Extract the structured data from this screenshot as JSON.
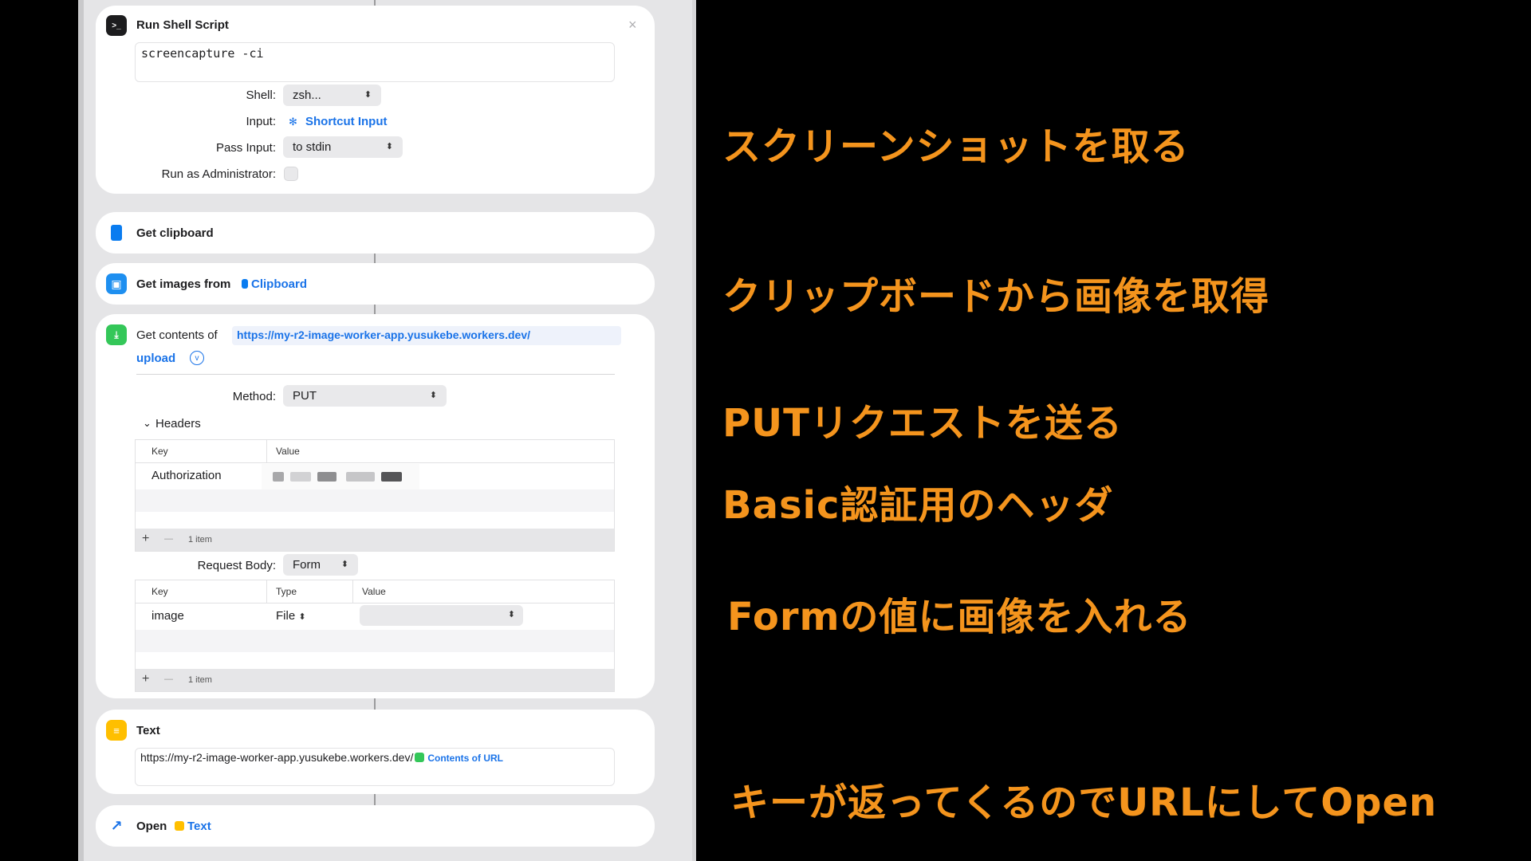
{
  "run_shell": {
    "title": "Run Shell Script",
    "script": "screencapture -ci",
    "shell_label": "Shell:",
    "shell_value": "zsh...",
    "input_label": "Input:",
    "input_value": "Shortcut Input",
    "pass_input_label": "Pass Input:",
    "pass_input_value": "to stdin",
    "admin_label": "Run as Administrator:"
  },
  "get_clipboard": {
    "title": "Get clipboard"
  },
  "get_images": {
    "title": "Get images from",
    "source": "Clipboard"
  },
  "get_contents": {
    "title": "Get contents of",
    "url_part1": "https://my-r2-image-worker-app.yusukebe.workers.dev/",
    "url_part2": "upload",
    "method_label": "Method:",
    "method_value": "PUT",
    "headers_label": "Headers",
    "headers_table": {
      "columns": [
        "Key",
        "Value"
      ],
      "rows": [
        {
          "key": "Authorization"
        }
      ],
      "count": "1 item"
    },
    "request_body_label": "Request Body:",
    "request_body_value": "Form",
    "form_table": {
      "columns": [
        "Key",
        "Type",
        "Value"
      ],
      "rows": [
        {
          "key": "image",
          "type": "File"
        }
      ],
      "count": "1 item"
    }
  },
  "text_action": {
    "title": "Text",
    "content": "https://my-r2-image-worker-app.yusukebe.workers.dev/",
    "token": "Contents of URL"
  },
  "open_action": {
    "title": "Open",
    "token": "Text"
  },
  "table_controls": {
    "add": "+",
    "remove": "—"
  },
  "annotations": [
    "スクリーンショットを取る",
    "クリップボードから画像を取得",
    "PUTリクエストを送る",
    "Basic認証用のヘッダ",
    "Formの値に画像を入れる",
    "キーが返ってくるのでURLにしてOpen"
  ],
  "colors": {
    "accent": "#f4941d",
    "link": "#1a73e8",
    "clipboard_icon": "#0a7cf0",
    "images_icon": "#1e8ff0",
    "contents_icon": "#34c759",
    "text_icon": "#ffbf00",
    "open_icon": "#1a73e8"
  }
}
